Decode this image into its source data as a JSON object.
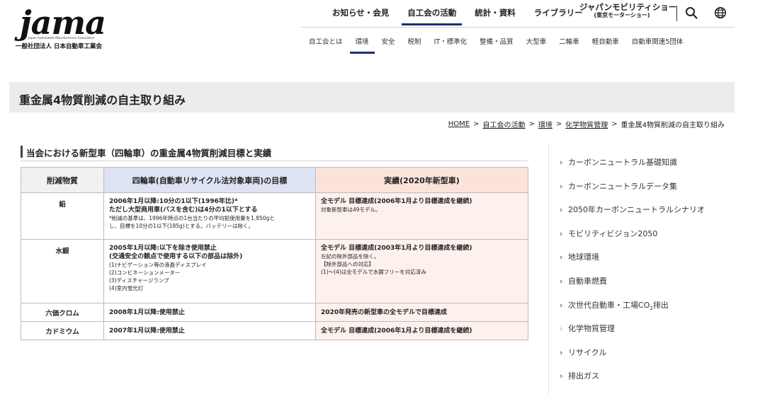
{
  "logo": {
    "word": "jama",
    "subtitle": "Japan Automobile Manufacturers Association",
    "org": "一般社団法人 日本自動車工業会"
  },
  "top_nav": [
    "お知らせ・会見",
    "自工会の活動",
    "統計・資料",
    "ライブラリー"
  ],
  "expo": {
    "line1": "ジャパンモビリティショー",
    "line2": "(東京モーターショー)"
  },
  "sub_nav": [
    "自工会とは",
    "環境",
    "安全",
    "税制",
    "IT・標準化",
    "整備・品質",
    "大型車",
    "二輪車",
    "軽自動車",
    "自動車関連5団体"
  ],
  "page_title": "重金属4物質削減の自主取り組み",
  "breadcrumb": {
    "items": [
      "HOME",
      "自工会の活動",
      "環境",
      "化学物質管理"
    ],
    "current": "重金属4物質削減の自主取り組み",
    "sep": ">"
  },
  "section_title": "当会における新型車（四輪車）の重金属4物質削減目標と実績",
  "table": {
    "headers": [
      "削減物質",
      "四輪車(自動車リサイクル法対象車両)の目標",
      "実績(2020年新型車)"
    ],
    "rows": [
      {
        "metal": "鉛",
        "target_bold": [
          "2006年1月以降:10分の1以下(1996年比)*",
          "ただし大型商用車(バスを含む)は4分の1以下とする"
        ],
        "target_small": [
          "*削減の基準は、1996年時点の1台当たりの平均鉛使用量を1,850gと",
          "し、目標を10分の1以下(185g)とする。バッテリーは除く。"
        ],
        "result_bold": [
          "全モデル 目標達成(2006年1月より目標達成を継続)"
        ],
        "result_small": [
          "対象新型車は49モデル。"
        ]
      },
      {
        "metal": "水銀",
        "target_bold": [
          "2005年1月以降:以下を除き使用禁止",
          "(交通安全の観点で使用する以下の部品は除外)"
        ],
        "target_small": [
          "(1)ナビゲーション等の液晶ディスプレイ",
          "(2)コンビネーションメーター",
          "(3)ディスチャージランプ",
          "(4)室内蛍光灯"
        ],
        "result_bold": [
          "全モデル 目標達成(2003年1月より目標達成を継続)"
        ],
        "result_small": [
          "左記の除外部品を除く。",
          "【除外部品への対応】",
          "(1)〜(4)は全モデルで水銀フリーを対応済み"
        ]
      },
      {
        "metal": "六価クロム",
        "target_bold": [
          "2008年1月以降:使用禁止"
        ],
        "target_small": [],
        "result_bold": [
          "2020年発売の新型車の全モデルで目標達成"
        ],
        "result_small": []
      },
      {
        "metal": "カドミウム",
        "target_bold": [
          "2007年1月以降:使用禁止"
        ],
        "target_small": [],
        "result_bold": [
          "全モデル 目標達成(2006年1月より目標達成を継続)"
        ],
        "result_small": []
      }
    ]
  },
  "sidebar": {
    "items": [
      "カーボンニュートラル基礎知識",
      "カーボンニュートラルデータ集",
      "2050年カーボンニュートラルシナリオ",
      "モビリティビジョン2050",
      "地球環境",
      "自動車燃費",
      "次世代自動車・工場CO",
      "化学物質管理",
      "リサイクル",
      "排出ガス"
    ],
    "co2_sub": "2",
    "co2_suffix": "排出",
    "active_index": 7,
    "chevron": "›"
  },
  "colors": {
    "nav_underline": "#1f2f6e",
    "sidebar_active_chevron": "#c9a53a",
    "header_target_bg": "#dde3f3",
    "header_result_bg": "#fbe3dc"
  }
}
